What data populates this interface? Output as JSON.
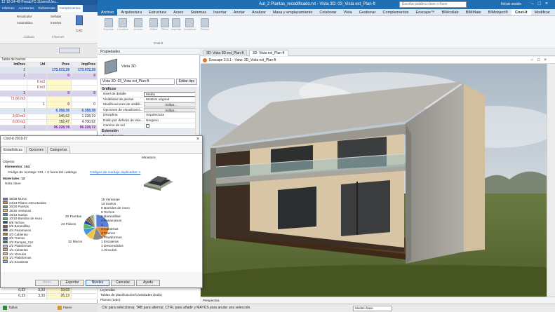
{
  "revit": {
    "title": "Aul_2 Plantas_recodificado.rvt - Vista 3D: 03_Vista ext_Plan-ft",
    "search_placeholder": "Escriba palabra clave o frase",
    "user": "Iniciar sesión",
    "tabs": [
      "Archivo",
      "Arquitectura",
      "Estructura",
      "Acero",
      "Sistemas",
      "Insertar",
      "Anotar",
      "Analizar",
      "Masa y emplazamiento",
      "Colaborar",
      "Vista",
      "Gestionar",
      "Complementos",
      "Enscape™",
      "BIMcollab",
      "BIMMate",
      "BIMobject®",
      "Cost-It",
      "Modificar"
    ],
    "active_tab": "Cost-It",
    "ribbon_buttons": [
      "Exportar",
      "Localizar",
      "Acceso",
      "Editar",
      "Filtrar",
      "Importar",
      "Actualizar",
      "Planos"
    ],
    "ribbon_group": "Cost-It",
    "colors": {
      "accent": "#1e6fb4",
      "tab_active": "#1e6fb4"
    }
  },
  "excel": {
    "title": "12 10-34-49 Presto7C-1Users/Usu...",
    "tabs": [
      "Informes",
      "Accesorios",
      "Referencias",
      "Complementos"
    ],
    "ribbon": [
      "Recalcular",
      "Señalar",
      "Automático",
      "Insertar",
      "Cálculo",
      "Informes",
      "CAD"
    ],
    "sheet_title": "Tabla de barras",
    "headers": [
      "ImPres",
      "Ud",
      "Pres",
      "ImpPres"
    ],
    "rows": [
      [
        "1",
        "",
        "173.072,39",
        "173.072,39"
      ],
      [
        "1",
        "",
        "0",
        "0"
      ],
      [
        "",
        "0 m3",
        "",
        ""
      ],
      [
        "",
        "0 m3",
        "",
        ""
      ],
      [
        "1",
        "",
        "0",
        "0"
      ],
      [
        "71,66 m3",
        "",
        "",
        ""
      ],
      [
        "",
        "1",
        "0",
        "0"
      ],
      [
        "1",
        "",
        "6.358,38",
        "6.358,38"
      ],
      [
        "3,60 m3",
        "",
        "345,62",
        "1.228,19"
      ],
      [
        "6,00 m3",
        "",
        "782,47",
        "4.700,92"
      ],
      [
        "1",
        "",
        "96.228,78",
        "96.228,72"
      ]
    ],
    "bottom_rows": [
      [
        "0,33",
        "3,33",
        "19,03",
        ""
      ],
      [
        "0,33",
        "3,33",
        "26,13",
        ""
      ]
    ],
    "status": [
      "Tablas",
      "Fases"
    ],
    "colors": {
      "blue_text": "#1c4fc4",
      "purple_text": "#7a1fa0",
      "red_text": "#c01e1e"
    }
  },
  "properties": {
    "title": "Propiedades",
    "type_name": "Vista 3D",
    "selector": "Vista 3D: 03_Vista ext_Plan-ft",
    "edit_type": "Editar tipo",
    "section_graphics": "Gráficos",
    "rows": [
      {
        "k": "Nivel de detalle",
        "v": "Medio"
      },
      {
        "k": "Visibilidad de piezas",
        "v": "Mostrar original"
      },
      {
        "k": "Modificaciones de visibili...",
        "v": "Editar...",
        "btn": true
      },
      {
        "k": "Opciones de visualizació...",
        "v": "Editar...",
        "btn": true
      },
      {
        "k": "Disciplina",
        "v": "Arquitectura"
      },
      {
        "k": "Estilo por defecto de visu...",
        "v": "Ninguno"
      },
      {
        "k": "Camino de sol",
        "v": ""
      }
    ],
    "section_extension": "Extensión",
    "section_extension_row": "Recortar vista"
  },
  "dialog": {
    "title": "Cost-It 2019.07",
    "close": "×",
    "tabs": [
      "Estadísticas",
      "Opciones",
      "Categorías"
    ],
    "active_tab": "Estadísticas",
    "section_label": "Objetos",
    "elements_label": "Elementos: 154",
    "codes_text": "Código de montaje: 131 + 0 fuera del catálogo",
    "duplicate_link": "Códigos de montaje duplicados: 1",
    "materials_label": "Materiales: 12",
    "see_rows": "Nota clave",
    "thumb_label": "Miniatura",
    "legend": [
      {
        "label": "38/38 Muros",
        "color": "#5a7fd6"
      },
      {
        "label": "24/24 Pilares estructurales",
        "color": "#e08a3a"
      },
      {
        "label": "20/20 Puertas",
        "color": "#888888"
      },
      {
        "label": "15/15 Ventanas",
        "color": "#f2c33d"
      },
      {
        "label": "13/13 Suelos",
        "color": "#3c9ad8"
      },
      {
        "label": "10/10 Barridos de muro",
        "color": "#5fb85f"
      },
      {
        "label": "8/8 Techos",
        "color": "#234c9e"
      },
      {
        "label": "6/6 Barandillas",
        "color": "#8c5a2d"
      },
      {
        "label": "4/4 Pasamanos",
        "color": "#555555"
      },
      {
        "label": "3/3 Cubiertas",
        "color": "#b58a1e"
      },
      {
        "label": "2/2 Tramos",
        "color": "#2d6fb0"
      },
      {
        "label": "2/2 Rampas_Cut",
        "color": "#2f7d3a"
      },
      {
        "label": "2/2 Plataformas",
        "color": "#a9bde6"
      },
      {
        "label": "1/1 Cubiertas",
        "color": "#f0a870"
      },
      {
        "label": "1/1 Vinculos",
        "color": "#bbbbbb"
      },
      {
        "label": "1/1 Plataformas",
        "color": "#f7d77a"
      },
      {
        "label": "1/1 Escaleras",
        "color": "#8fc4ec"
      }
    ],
    "pie_labels_left": [
      "20 Puertas",
      "24 Pilares",
      "32 Muros"
    ],
    "pie_labels_right": [
      "15 Ventanas",
      "13 Suelos",
      "8 Barridos de muro",
      "8 Techos",
      "6 Barandillas",
      "4 Pasamanos",
      "3",
      "3 Cubiertas",
      "2 Tramos",
      "1 Plataformas",
      "1 Escaleras",
      "1 Descendidos",
      "1 Vinculos"
    ],
    "pie_values": [
      38,
      24,
      20,
      15,
      13,
      10,
      8,
      6,
      4,
      3,
      2,
      2,
      2,
      1,
      1,
      1,
      1
    ],
    "buttons": [
      "Atrás",
      "Exportar",
      "Niveles",
      "Cancelar",
      "Ayuda"
    ]
  },
  "project_tree": {
    "items": [
      "Leyendas",
      "Tablas de planificación/Cantidades (todo)",
      "Planos (todo)"
    ]
  },
  "viewtabs": [
    "3D: Vista 3D ext_Plan-ft",
    "3D: Vista ext_Plan-ft"
  ],
  "enscape": {
    "title": "Enscape 2.6.1 - View: 3D_Vista ext_Plan-ft"
  },
  "view_bar": "Perspectiva",
  "status": {
    "message": "Clic para seleccionar, TAB para alternar, CTRL para añadir y MAYÚS para anular una selección.",
    "model": "Modelo base"
  }
}
